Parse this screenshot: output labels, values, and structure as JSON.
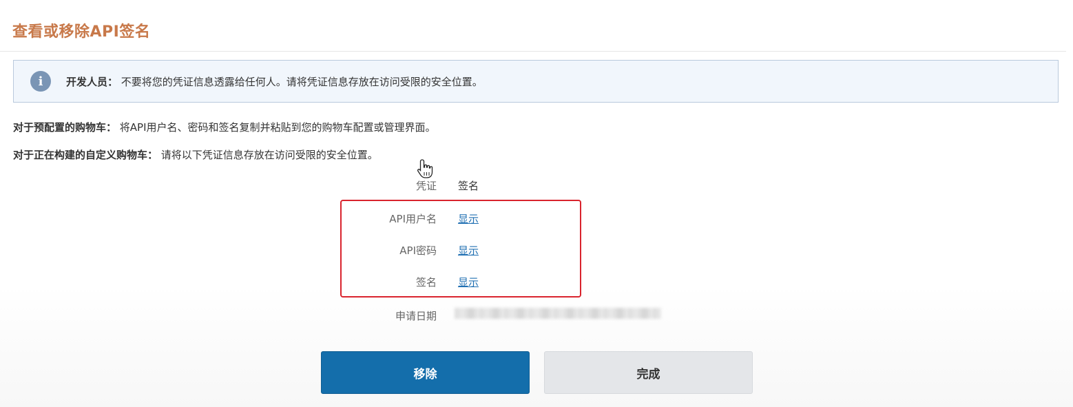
{
  "dialog": {
    "title": "查看或移除API签名"
  },
  "notice": {
    "icon": "info-icon",
    "label": "开发人员：",
    "text": "不要将您的凭证信息透露给任何人。请将凭证信息存放在访问受限的安全位置。"
  },
  "instructions": {
    "preconfigured_label": "对于预配置的购物车：",
    "preconfigured_text": "将API用户名、密码和签名复制并粘贴到您的购物车配置或管理界面。",
    "custom_label": "对于正在构建的自定义购物车：",
    "custom_text": "请将以下凭证信息存放在访问受限的安全位置。"
  },
  "credentials": {
    "header_label": "凭证",
    "header_value": "签名",
    "rows": [
      {
        "label": "API用户名",
        "action": "显示"
      },
      {
        "label": "API密码",
        "action": "显示"
      },
      {
        "label": "签名",
        "action": "显示"
      }
    ],
    "date_label": "申请日期"
  },
  "buttons": {
    "remove": "移除",
    "done": "完成"
  },
  "colors": {
    "title": "#c8794a",
    "primary": "#146eab",
    "highlight_box": "#d9232d",
    "link": "#1f6fb2"
  }
}
